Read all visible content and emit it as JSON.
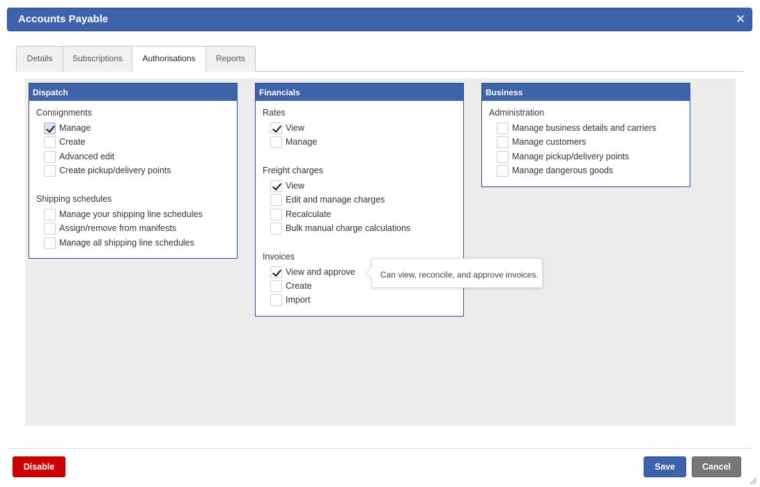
{
  "window": {
    "title": "Accounts Payable",
    "close_icon": "close-icon"
  },
  "tabs": [
    {
      "label": "Details",
      "active": false
    },
    {
      "label": "Subscriptions",
      "active": false
    },
    {
      "label": "Authorisations",
      "active": true
    },
    {
      "label": "Reports",
      "active": false
    }
  ],
  "panels": {
    "dispatch": {
      "title": "Dispatch",
      "groups": [
        {
          "title": "Consignments",
          "items": [
            {
              "label": "Manage",
              "checked": true
            },
            {
              "label": "Create",
              "checked": false
            },
            {
              "label": "Advanced edit",
              "checked": false
            },
            {
              "label": "Create pickup/delivery points",
              "checked": false
            }
          ]
        },
        {
          "title": "Shipping schedules",
          "items": [
            {
              "label": "Manage your shipping line schedules",
              "checked": false
            },
            {
              "label": "Assign/remove from manifests",
              "checked": false
            },
            {
              "label": "Manage all shipping line schedules",
              "checked": false
            }
          ]
        }
      ]
    },
    "financials": {
      "title": "Financials",
      "groups": [
        {
          "title": "Rates",
          "items": [
            {
              "label": "View",
              "checked": true
            },
            {
              "label": "Manage",
              "checked": false
            }
          ]
        },
        {
          "title": "Freight charges",
          "items": [
            {
              "label": "View",
              "checked": true
            },
            {
              "label": "Edit and manage charges",
              "checked": false
            },
            {
              "label": "Recalculate",
              "checked": false
            },
            {
              "label": "Bulk manual charge calculations",
              "checked": false
            }
          ]
        },
        {
          "title": "Invoices",
          "items": [
            {
              "label": "View and approve",
              "checked": true
            },
            {
              "label": "Create",
              "checked": false
            },
            {
              "label": "Import",
              "checked": false
            }
          ]
        }
      ]
    },
    "business": {
      "title": "Business",
      "groups": [
        {
          "title": "Administration",
          "items": [
            {
              "label": "Manage business details and carriers",
              "checked": false
            },
            {
              "label": "Manage customers",
              "checked": false
            },
            {
              "label": "Manage pickup/delivery points",
              "checked": false
            },
            {
              "label": "Manage dangerous goods",
              "checked": false
            }
          ]
        }
      ]
    }
  },
  "tooltip": {
    "text": "Can view, reconcile, and approve invoices."
  },
  "footer": {
    "disable_label": "Disable",
    "save_label": "Save",
    "cancel_label": "Cancel"
  },
  "colors": {
    "header_blue": "#3d63ab",
    "disable_red": "#cc0000",
    "cancel_gray": "#777777",
    "content_bg": "#ececec"
  }
}
